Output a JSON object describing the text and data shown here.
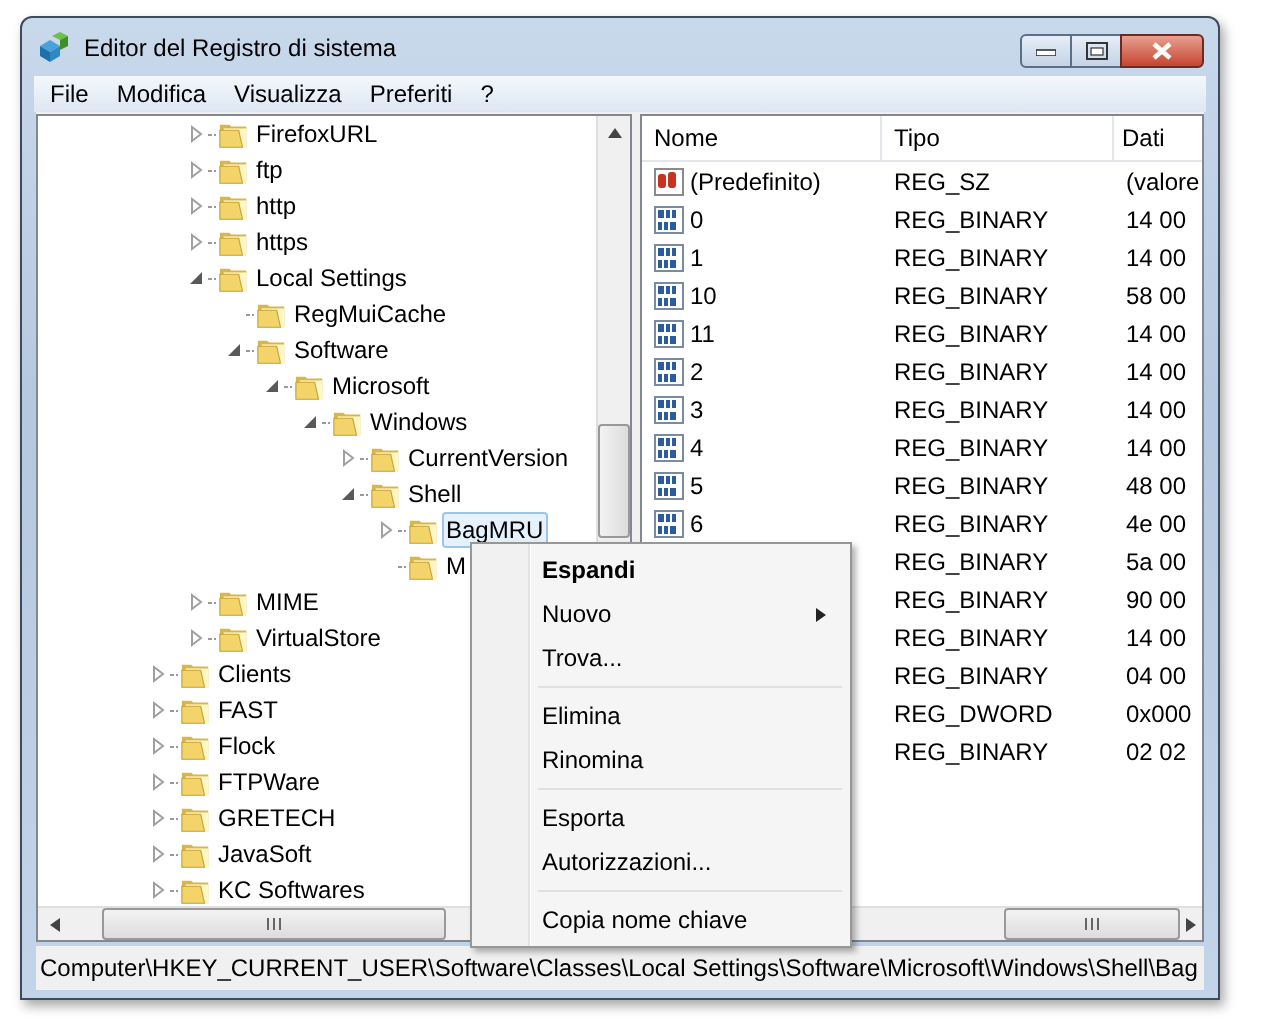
{
  "window": {
    "title": "Editor del Registro di sistema"
  },
  "menu_bar": [
    "File",
    "Modifica",
    "Visualizza",
    "Preferiti",
    "?"
  ],
  "tree": {
    "items": [
      {
        "children": [
          {
            "label": "FirefoxURL",
            "expanded": false,
            "selected": false
          },
          {
            "label": "ftp",
            "expanded": false,
            "selected": false
          },
          {
            "label": "http",
            "expanded": false,
            "selected": false
          },
          {
            "label": "https",
            "expanded": false,
            "selected": false
          },
          {
            "label": "Local Settings",
            "expanded": true,
            "selected": false,
            "children": [
              {
                "label": "RegMuiCache",
                "selected": false
              },
              {
                "label": "Software",
                "expanded": true,
                "selected": false,
                "children": [
                  {
                    "label": "Microsoft",
                    "expanded": true,
                    "selected": false,
                    "children": [
                      {
                        "label": "Windows",
                        "expanded": true,
                        "selected": false,
                        "children": [
                          {
                            "label": "CurrentVersion",
                            "expanded": false,
                            "selected": false
                          },
                          {
                            "label": "Shell",
                            "expanded": true,
                            "selected": false,
                            "children": [
                              {
                                "label": "BagMRU",
                                "expanded": false,
                                "selected": true
                              },
                              {
                                "label": "M",
                                "selected": false
                              }
                            ]
                          }
                        ]
                      }
                    ]
                  }
                ]
              }
            ]
          },
          {
            "label": "MIME",
            "expanded": false,
            "selected": false
          },
          {
            "label": "VirtualStore",
            "expanded": false,
            "selected": false
          }
        ]
      },
      {
        "label": "Clients",
        "expanded": false,
        "selected": false
      },
      {
        "label": "FAST",
        "expanded": false,
        "selected": false
      },
      {
        "label": "Flock",
        "expanded": false,
        "selected": false
      },
      {
        "label": "FTPWare",
        "expanded": false,
        "selected": false
      },
      {
        "label": "GRETECH",
        "expanded": false,
        "selected": false
      },
      {
        "label": "JavaSoft",
        "expanded": false,
        "selected": false
      },
      {
        "label": "KC Softwares",
        "expanded": false,
        "selected": false
      }
    ]
  },
  "values": {
    "columns": [
      "Nome",
      "Tipo",
      "Dati"
    ],
    "rows": [
      {
        "kind": "string",
        "name": "(Predefinito)",
        "type": "REG_SZ",
        "data": "(valore"
      },
      {
        "kind": "binary",
        "name": "0",
        "type": "REG_BINARY",
        "data": "14 00"
      },
      {
        "kind": "binary",
        "name": "1",
        "type": "REG_BINARY",
        "data": "14 00"
      },
      {
        "kind": "binary",
        "name": "10",
        "type": "REG_BINARY",
        "data": "58 00"
      },
      {
        "kind": "binary",
        "name": "11",
        "type": "REG_BINARY",
        "data": "14 00"
      },
      {
        "kind": "binary",
        "name": "2",
        "type": "REG_BINARY",
        "data": "14 00"
      },
      {
        "kind": "binary",
        "name": "3",
        "type": "REG_BINARY",
        "data": "14 00"
      },
      {
        "kind": "binary",
        "name": "4",
        "type": "REG_BINARY",
        "data": "14 00"
      },
      {
        "kind": "binary",
        "name": "5",
        "type": "REG_BINARY",
        "data": "48 00"
      },
      {
        "kind": "binary",
        "name": "6",
        "type": "REG_BINARY",
        "data": "4e 00"
      },
      {
        "type": "REG_BINARY",
        "data": "5a 00"
      },
      {
        "type": "REG_BINARY",
        "data": "90 00"
      },
      {
        "type": "REG_BINARY",
        "data": "14 00"
      },
      {
        "type": "REG_BINARY",
        "data": "04 00"
      },
      {
        "type": "REG_DWORD",
        "data": "0x000"
      },
      {
        "type": "REG_BINARY",
        "data": "02 02"
      }
    ]
  },
  "context_menu": {
    "items": [
      {
        "kind": "item",
        "label": "Espandi",
        "default": true,
        "submenu": false
      },
      {
        "kind": "item",
        "label": "Nuovo",
        "default": false,
        "submenu": true
      },
      {
        "kind": "item",
        "label": "Trova...",
        "default": false,
        "submenu": false
      },
      {
        "kind": "separator"
      },
      {
        "kind": "item",
        "label": "Elimina",
        "default": false,
        "submenu": false
      },
      {
        "kind": "item",
        "label": "Rinomina",
        "default": false,
        "submenu": false
      },
      {
        "kind": "separator"
      },
      {
        "kind": "item",
        "label": "Esporta",
        "default": false,
        "submenu": false
      },
      {
        "kind": "item",
        "label": "Autorizzazioni...",
        "default": false,
        "submenu": false
      },
      {
        "kind": "separator"
      },
      {
        "kind": "item",
        "label": "Copia nome chiave",
        "default": false,
        "submenu": false
      }
    ]
  },
  "status_bar": "Computer\\HKEY_CURRENT_USER\\Software\\Classes\\Local Settings\\Software\\Microsoft\\Windows\\Shell\\Bag"
}
